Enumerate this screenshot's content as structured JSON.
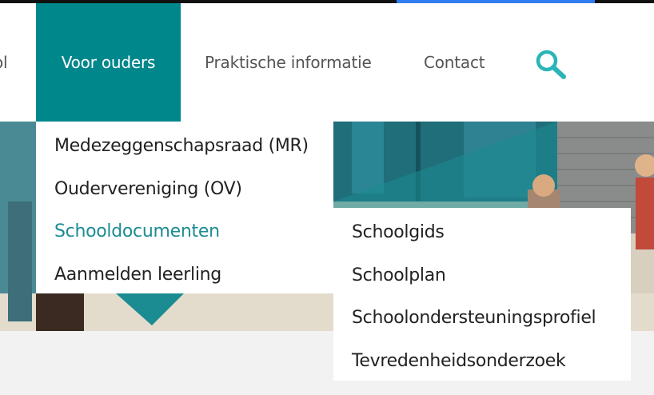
{
  "nav": {
    "partial_label": "ol",
    "items": [
      {
        "label": "Voor ouders"
      },
      {
        "label": "Praktische informatie"
      },
      {
        "label": "Contact"
      }
    ],
    "search_icon": "search-icon"
  },
  "dropdown": {
    "items": [
      {
        "label": "Medezeggenschapsraad (MR)"
      },
      {
        "label": "Oudervereniging (OV)"
      },
      {
        "label": "Schooldocumenten"
      },
      {
        "label": "Aanmelden leerling"
      }
    ]
  },
  "submenu": {
    "items": [
      {
        "label": "Schoolgids"
      },
      {
        "label": "Schoolplan"
      },
      {
        "label": "Schoolondersteuningsprofiel"
      },
      {
        "label": "Tevredenheidsonderzoek"
      }
    ]
  },
  "colors": {
    "accent": "#00878c",
    "highlight_text": "#1c8c93",
    "icon": "#2bb5b8"
  }
}
